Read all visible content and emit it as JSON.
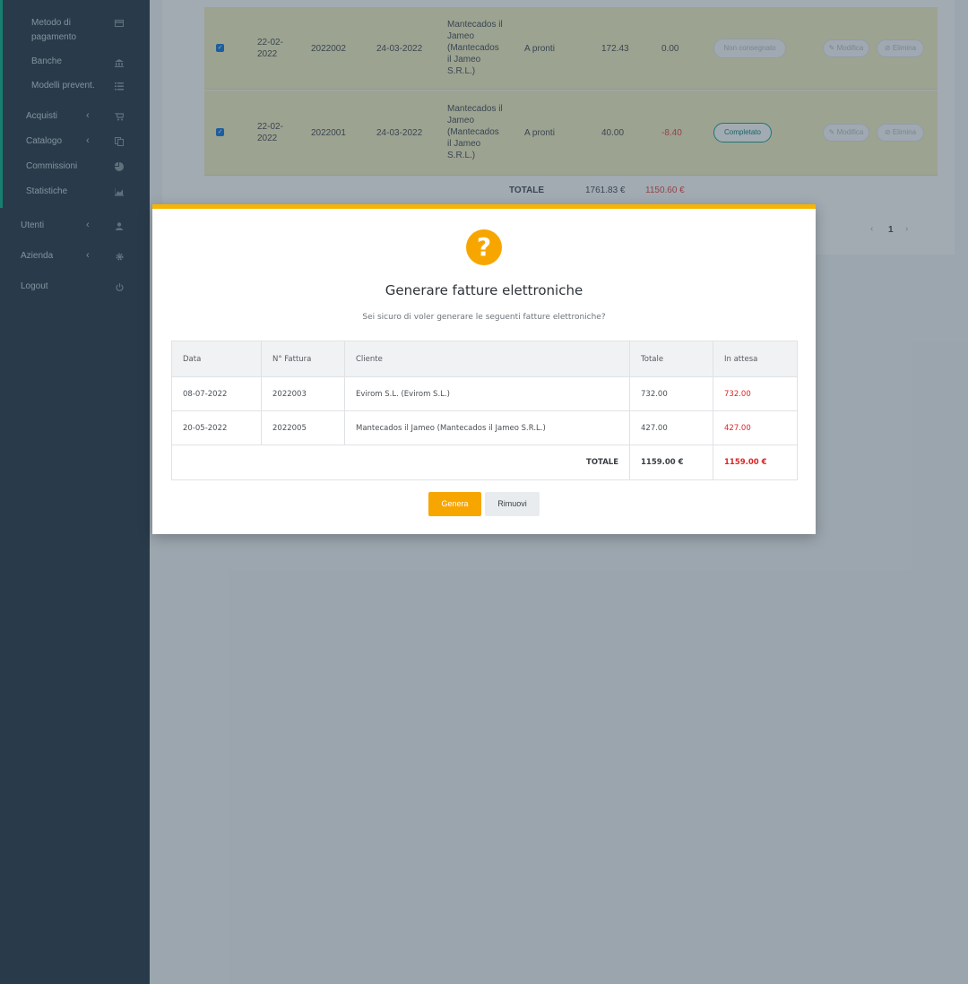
{
  "sidebar": {
    "items": [
      {
        "label": "Metodo di pagamento",
        "icon": "credit-card-icon"
      },
      {
        "label": "Banche",
        "icon": "bank-icon"
      },
      {
        "label": "Modelli prevent.",
        "icon": "list-icon"
      },
      {
        "label": "Acquisti",
        "icon": "cart-icon"
      },
      {
        "label": "Catalogo",
        "icon": "copy-icon"
      },
      {
        "label": "Commissioni",
        "icon": "pie-icon"
      },
      {
        "label": "Statistiche",
        "icon": "chart-icon"
      },
      {
        "label": "Utenti",
        "icon": "user-icon"
      },
      {
        "label": "Azienda",
        "icon": "gear-icon"
      },
      {
        "label": "Logout",
        "icon": "power-icon"
      }
    ]
  },
  "background": {
    "rows": [
      {
        "date": "22-02-2022",
        "number": "2022002",
        "due": "24-03-2022",
        "client": "Mantecados il Jameo (Mantecados il Jameo S.R.L.)",
        "payment": "A pronti",
        "total": "172.43",
        "pending": "0.00",
        "status": "Non consegnato",
        "edit": "Modifica",
        "delete": "Elimina"
      },
      {
        "date": "22-02-2022",
        "number": "2022001",
        "due": "24-03-2022",
        "client": "Mantecados il Jameo (Mantecados il Jameo S.R.L.)",
        "payment": "A pronti",
        "total": "40.00",
        "pending": "-8.40",
        "status": "Completato",
        "edit": "Modifica",
        "delete": "Elimina"
      }
    ],
    "totals": {
      "label": "TOTALE",
      "total": "1761.83 €",
      "pending": "1150.60 €"
    },
    "pagination": {
      "prev": "‹",
      "page": "1",
      "next": "›"
    }
  },
  "modal": {
    "icon": "question-icon",
    "title": "Generare fatture elettroniche",
    "subtitle": "Sei sicuro di voler generare le seguenti fatture elettroniche?",
    "columns": [
      "Data",
      "N° Fattura",
      "Cliente",
      "Totale",
      "In attesa"
    ],
    "rows": [
      {
        "date": "08-07-2022",
        "number": "2022003",
        "client": "Evirom S.L. (Evirom S.L.)",
        "total": "732.00",
        "pending": "732.00"
      },
      {
        "date": "20-05-2022",
        "number": "2022005",
        "client": "Mantecados il Jameo (Mantecados il Jameo S.R.L.)",
        "total": "427.00",
        "pending": "427.00"
      }
    ],
    "footer": {
      "label": "TOTALE",
      "total": "1159.00 €",
      "pending": "1159.00 €"
    },
    "buttons": {
      "confirm": "Genera",
      "cancel": "Rimuovi"
    }
  },
  "colors": {
    "accent": "#f7a600",
    "danger": "#e02424",
    "sidebar": "#2f3f4e",
    "sidebar_accent": "#12b28c",
    "status_teal": "#19a59a"
  }
}
